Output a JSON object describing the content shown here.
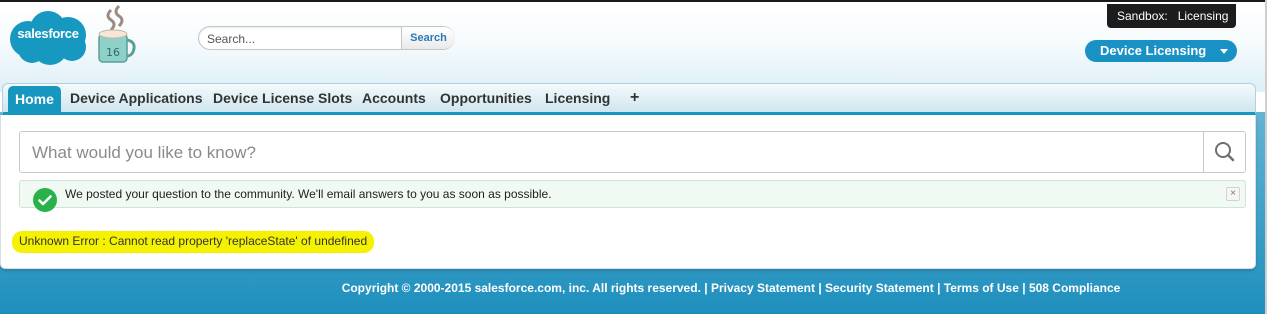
{
  "header": {
    "logo_text": "salesforce",
    "mascot_badge": "16",
    "search": {
      "placeholder": "Search...",
      "button_label": "Search"
    },
    "sandbox_label": "Sandbox:   Licensing",
    "app_menu_label": "Device Licensing"
  },
  "tabs": [
    {
      "label": "Home",
      "active": true
    },
    {
      "label": "Device Applications"
    },
    {
      "label": "Device License Slots"
    },
    {
      "label": "Accounts"
    },
    {
      "label": "Opportunities"
    },
    {
      "label": "Licensing"
    },
    {
      "label": "+"
    }
  ],
  "main": {
    "question_placeholder": "What would you like to know?",
    "notice_text": "We posted your question to the community. We'll email answers to you as soon as possible.",
    "notice_close": "×",
    "error_text": "Unknown Error : Cannot read property 'replaceState' of undefined"
  },
  "footer": {
    "copyright": "Copyright © 2000-2015 salesforce.com, inc. All rights reserved.",
    "sep": " | ",
    "links": [
      "Privacy Statement",
      "Security Statement",
      "Terms of Use",
      "508 Compliance"
    ]
  },
  "colors": {
    "brand_blue": "#1a91c4",
    "tab_active": "#1797c0",
    "error_highlight": "#f4f200",
    "success_green": "#2ab24a"
  },
  "icons": {
    "ask_button": "search-icon",
    "notice": "check-circle-icon",
    "app_menu": "caret-down-icon"
  }
}
